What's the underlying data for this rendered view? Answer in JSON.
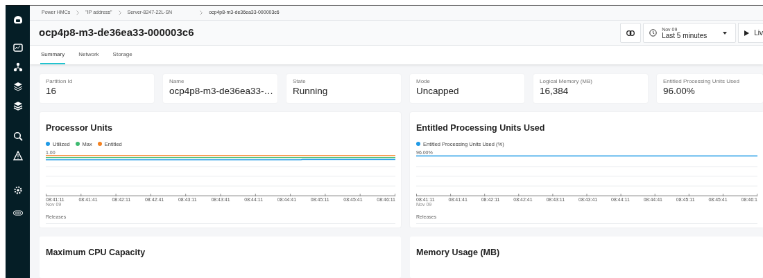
{
  "breadcrumbs": [
    {
      "label": "Power HMCs"
    },
    {
      "label": "\"IP address\""
    },
    {
      "label": "Server-8247-22L-SN"
    },
    {
      "label": "ocp4p8-m3-de36ea33-000003c6"
    }
  ],
  "header": {
    "title": "ocp4p8-m3-de36ea33-000003c6",
    "time_range": {
      "date": "Nov 09",
      "label": "Last 5 minutes"
    },
    "live_button": "Liv"
  },
  "tabs": [
    {
      "label": "Summary",
      "selected": true
    },
    {
      "label": "Network",
      "selected": false
    },
    {
      "label": "Storage",
      "selected": false
    }
  ],
  "metrics": [
    {
      "label": "Partition Id",
      "value": "16"
    },
    {
      "label": "Name",
      "value": "ocp4p8-m3-de36ea33-…"
    },
    {
      "label": "State",
      "value": "Running"
    },
    {
      "label": "Mode",
      "value": "Uncapped"
    },
    {
      "label": "Logical Memory (MB)",
      "value": "16,384"
    },
    {
      "label": "Entitled Processing Units Used",
      "value": "96.00%"
    }
  ],
  "charts": [
    {
      "title": "Processor Units",
      "legend": [
        {
          "label": "Utilized",
          "color": "#1f9ae6"
        },
        {
          "label": "Max",
          "color": "#3dba70"
        },
        {
          "label": "Entitled",
          "color": "#f58220"
        }
      ],
      "top_label": "1.00",
      "x_labels": [
        "08:41:11",
        "08:41:41",
        "08:42:11",
        "08:42:41",
        "08:43:11",
        "08:43:41",
        "08:44:11",
        "08:44:41",
        "08:45:11",
        "08:45:41",
        "08:46:11"
      ],
      "date_label": "Nov 09",
      "footer": "Releases"
    },
    {
      "title": "Entitled Processing Units Used",
      "legend": [
        {
          "label": "Entitled Processing Units Used (%)",
          "color": "#1f9ae6"
        }
      ],
      "top_label": "96.00%",
      "x_labels": [
        "08:41:11",
        "08:41:41",
        "08:42:11",
        "08:42:41",
        "08:43:11",
        "08:43:41",
        "08:44:11",
        "08:44:41",
        "08:45:11",
        "08:45:41",
        "08:46:1"
      ],
      "date_label": "Nov 09",
      "footer": "Releases"
    }
  ],
  "lower_cards": [
    {
      "title": "Maximum CPU Capacity"
    },
    {
      "title": "Memory Usage (MB)"
    }
  ]
}
